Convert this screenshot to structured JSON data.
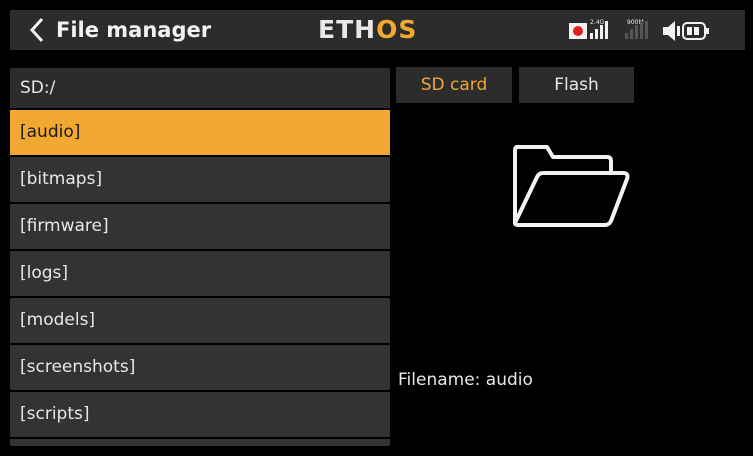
{
  "header": {
    "title": "File manager",
    "logo_main": "ETH",
    "logo_accent": "OS",
    "signal_24_label": "2.4G",
    "signal_900_label": "900M"
  },
  "icons": {
    "back": "chevron-left-icon",
    "record": "record-icon",
    "signal": "signal-bars-icon",
    "volume": "speaker-icon",
    "battery": "battery-icon",
    "folder": "folder-open-icon"
  },
  "colors": {
    "accent": "#f0a830",
    "panel": "#2c2c2c",
    "row": "#333333",
    "background": "#000000",
    "record": "#e02020"
  },
  "browser": {
    "path": "SD:/",
    "items": [
      "[audio]",
      "[bitmaps]",
      "[firmware]",
      "[logs]",
      "[models]",
      "[screenshots]",
      "[scripts]"
    ],
    "selected_index": 0
  },
  "tabs": {
    "sd_card": "SD card",
    "flash": "Flash",
    "active": "SD card"
  },
  "details": {
    "filename_label": "Filename: audio"
  }
}
